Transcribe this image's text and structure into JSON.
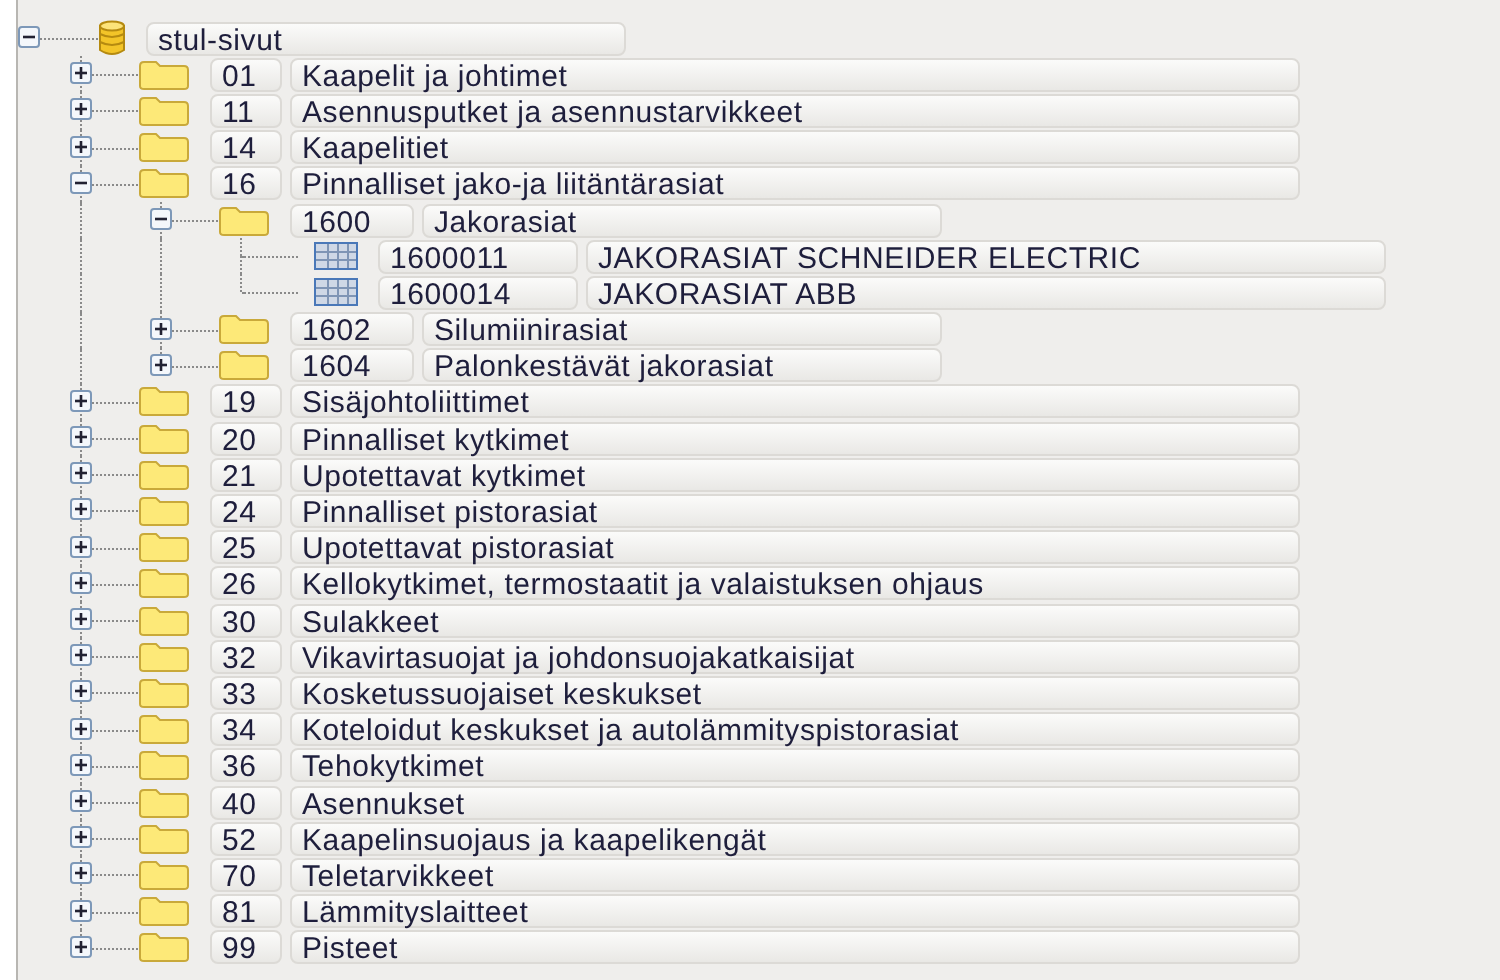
{
  "tree": [
    {
      "kind": "database",
      "name": "stul-sivut",
      "expanded": true,
      "children": [
        {
          "kind": "folder",
          "code": "01",
          "name": "Kaapelit ja johtimet",
          "expanded": false
        },
        {
          "kind": "folder",
          "code": "11",
          "name": "Asennusputket ja asennustarvikkeet",
          "expanded": false
        },
        {
          "kind": "folder",
          "code": "14",
          "name": "Kaapelitiet",
          "expanded": false
        },
        {
          "kind": "folder",
          "code": "16",
          "name": "Pinnalliset jako-ja liitäntärasiat",
          "expanded": true,
          "children": [
            {
              "kind": "folder",
              "code": "1600",
              "name": "Jakorasiat",
              "expanded": true,
              "children": [
                {
                  "kind": "table",
                  "code": "1600011",
                  "name": "JAKORASIAT SCHNEIDER ELECTRIC"
                },
                {
                  "kind": "table",
                  "code": "1600014",
                  "name": "JAKORASIAT ABB"
                }
              ]
            },
            {
              "kind": "folder",
              "code": "1602",
              "name": "Silumiinirasiat",
              "expanded": false
            },
            {
              "kind": "folder",
              "code": "1604",
              "name": "Palonkestävät jakorasiat",
              "expanded": false
            }
          ]
        },
        {
          "kind": "folder",
          "code": "19",
          "name": "Sisäjohtoliittimet",
          "expanded": false
        },
        {
          "kind": "folder",
          "code": "20",
          "name": "Pinnalliset kytkimet",
          "expanded": false
        },
        {
          "kind": "folder",
          "code": "21",
          "name": "Upotettavat kytkimet",
          "expanded": false
        },
        {
          "kind": "folder",
          "code": "24",
          "name": "Pinnalliset pistorasiat",
          "expanded": false
        },
        {
          "kind": "folder",
          "code": "25",
          "name": "Upotettavat pistorasiat",
          "expanded": false
        },
        {
          "kind": "folder",
          "code": "26",
          "name": "Kellokytkimet, termostaatit ja valaistuksen ohjaus",
          "expanded": false
        },
        {
          "kind": "folder",
          "code": "30",
          "name": "Sulakkeet",
          "expanded": false
        },
        {
          "kind": "folder",
          "code": "32",
          "name": "Vikavirtasuojat ja johdonsuojakatkaisijat",
          "expanded": false
        },
        {
          "kind": "folder",
          "code": "33",
          "name": "Kosketussuojaiset keskukset",
          "expanded": false
        },
        {
          "kind": "folder",
          "code": "34",
          "name": "Koteloidut keskukset ja autolämmityspistorasiat",
          "expanded": false
        },
        {
          "kind": "folder",
          "code": "36",
          "name": "Tehokytkimet",
          "expanded": false
        },
        {
          "kind": "folder",
          "code": "40",
          "name": "Asennukset",
          "expanded": false
        },
        {
          "kind": "folder",
          "code": "52",
          "name": "Kaapelinsuojaus ja kaapelikengät",
          "expanded": false
        },
        {
          "kind": "folder",
          "code": "70",
          "name": "Teletarvikkeet",
          "expanded": false
        },
        {
          "kind": "folder",
          "code": "81",
          "name": "Lämmityslaitteet",
          "expanded": false
        },
        {
          "kind": "folder",
          "code": "99",
          "name": "Pisteet",
          "expanded": false
        }
      ]
    }
  ]
}
